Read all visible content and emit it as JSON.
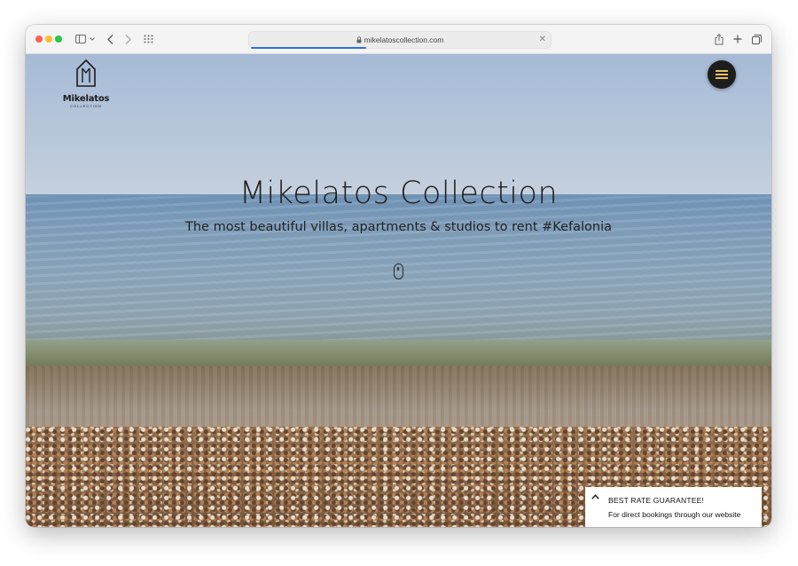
{
  "browser": {
    "url": "mikelatoscollection.com",
    "icons": [
      "sidebar-icon",
      "chevron-down-icon",
      "back-icon",
      "forward-icon",
      "tab-grid-icon",
      "lock-icon",
      "close-icon",
      "share-icon",
      "new-tab-icon",
      "tabs-overview-icon"
    ]
  },
  "site": {
    "logo_text": "Mikelatos",
    "logo_subtext": "COLLECTION",
    "title": "Mikelatos Collection",
    "subtitle": "The most beautiful villas, apartments & studios to rent #Kefalonia"
  },
  "rate_banner": {
    "title": "BEST RATE GUARANTEE!",
    "text": "For direct bookings through our website"
  },
  "colors": {
    "menu_button_bg": "#1d1d1d",
    "menu_button_lines": "#e8c25a",
    "progress_bar": "#2b6de3"
  }
}
